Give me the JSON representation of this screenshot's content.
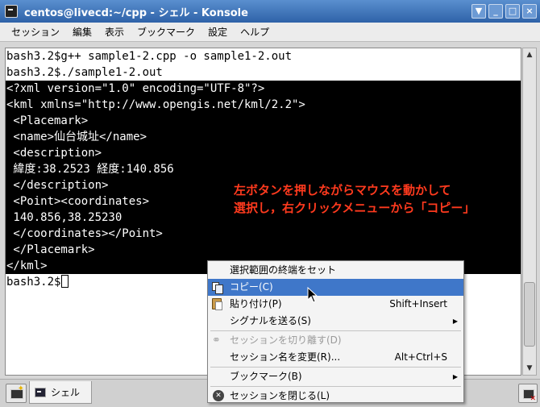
{
  "window": {
    "title": "centos@livecd:~/cpp - シェル - Konsole",
    "buttons": [
      "▼",
      "_",
      "□",
      "×"
    ]
  },
  "menubar": [
    "セッション",
    "編集",
    "表示",
    "ブックマーク",
    "設定",
    "ヘルプ"
  ],
  "terminal": {
    "lines": [
      "bash3.2$g++ sample1-2.cpp -o sample1-2.out",
      "bash3.2$./sample1-2.out",
      "<?xml version=\"1.0\" encoding=\"UTF-8\"?>",
      "<kml xmlns=\"http://www.opengis.net/kml/2.2\">",
      " <Placemark>",
      " <name>仙台城址</name>",
      " <description>",
      " 緯度:38.2523 経度:140.856",
      " </description>",
      " <Point><coordinates>",
      " 140.856,38.25230",
      " </coordinates></Point>",
      " </Placemark>",
      "</kml>"
    ],
    "prompt": "bash3.2$"
  },
  "annotation": {
    "line1": "左ボタンを押しながらマウスを動かして",
    "line2": "選択し，右クリックメニューから「コピー」"
  },
  "context_menu": {
    "items": [
      {
        "label": "選択範囲の終端をセット",
        "shortcut": ""
      },
      {
        "label": "コピー(C)",
        "shortcut": ""
      },
      {
        "label": "貼り付け(P)",
        "shortcut": "Shift+Insert"
      },
      {
        "label": "シグナルを送る(S)",
        "shortcut": ""
      },
      {
        "label": "セッションを切り離す(D)",
        "shortcut": ""
      },
      {
        "label": "セッション名を変更(R)...",
        "shortcut": "Alt+Ctrl+S"
      },
      {
        "label": "ブックマーク(B)",
        "shortcut": ""
      },
      {
        "label": "セッションを閉じる(L)",
        "shortcut": ""
      }
    ]
  },
  "tabbar": {
    "tab_label": "シェル"
  },
  "colors": {
    "title_bar": "#3b6fb5",
    "menu_highlight": "#3f77c9",
    "annotation": "#ff3a1e",
    "selection_bg": "#000000"
  }
}
